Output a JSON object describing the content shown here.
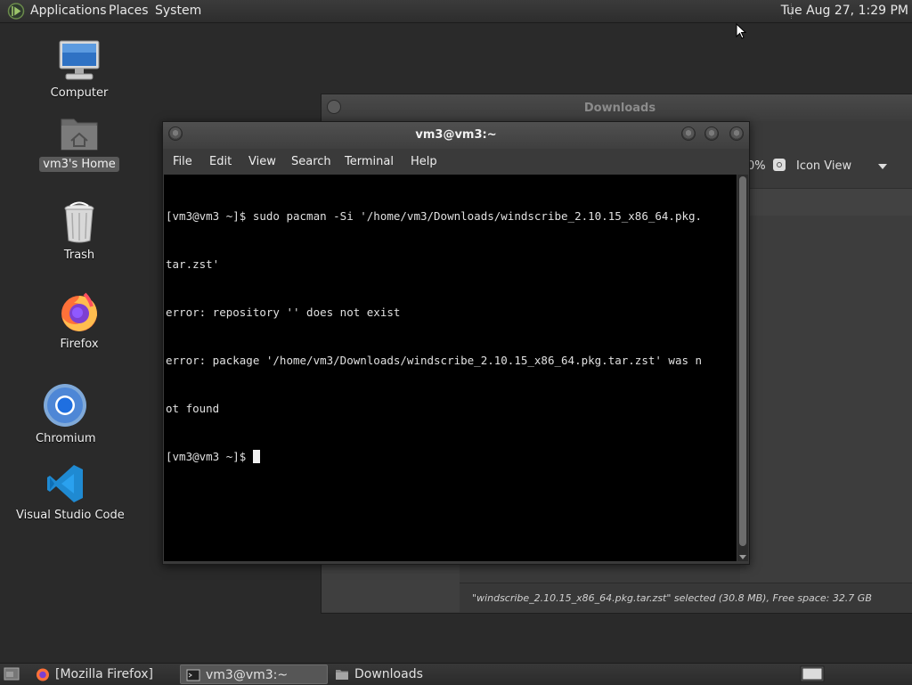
{
  "top_panel": {
    "menus": [
      "Applications",
      "Places",
      "System"
    ],
    "clock": "Tue Aug 27,  1:29 PM"
  },
  "desktop": {
    "icons": [
      {
        "label": "Computer",
        "icon": "computer-icon"
      },
      {
        "label": "vm3's Home",
        "icon": "home-folder-icon",
        "selected": true
      },
      {
        "label": "Trash",
        "icon": "trash-icon"
      },
      {
        "label": "Firefox",
        "icon": "firefox-icon"
      },
      {
        "label": "Chromium",
        "icon": "chromium-icon"
      },
      {
        "label": "Visual Studio Code",
        "icon": "vscode-icon"
      }
    ]
  },
  "downloads_window": {
    "title": "Downloads",
    "zoom": "0%",
    "view_mode": "Icon View",
    "status": "\"windscribe_2.10.15_x86_64.pkg.tar.zst\" selected (30.8 MB), Free space: 32.7 GB"
  },
  "terminal": {
    "title": "vm3@vm3:~",
    "menu": [
      "File",
      "Edit",
      "View",
      "Search",
      "Terminal",
      "Help"
    ],
    "lines": [
      "[vm3@vm3 ~]$ sudo pacman -Si '/home/vm3/Downloads/windscribe_2.10.15_x86_64.pkg.",
      "tar.zst'",
      "error: repository '' does not exist",
      "error: package '/home/vm3/Downloads/windscribe_2.10.15_x86_64.pkg.tar.zst' was n",
      "ot found"
    ],
    "prompt": "[vm3@vm3 ~]$ "
  },
  "taskbar": {
    "tasks": [
      {
        "label": "[Mozilla Firefox]",
        "icon": "firefox-icon",
        "active": false
      },
      {
        "label": "vm3@vm3:~",
        "icon": "terminal-icon",
        "active": true
      },
      {
        "label": "Downloads",
        "icon": "folder-icon",
        "active": false
      }
    ]
  },
  "colors": {
    "desktop_bg": "#2a2a2a",
    "terminal_bg": "#000000",
    "panel_bg": "#333333"
  }
}
